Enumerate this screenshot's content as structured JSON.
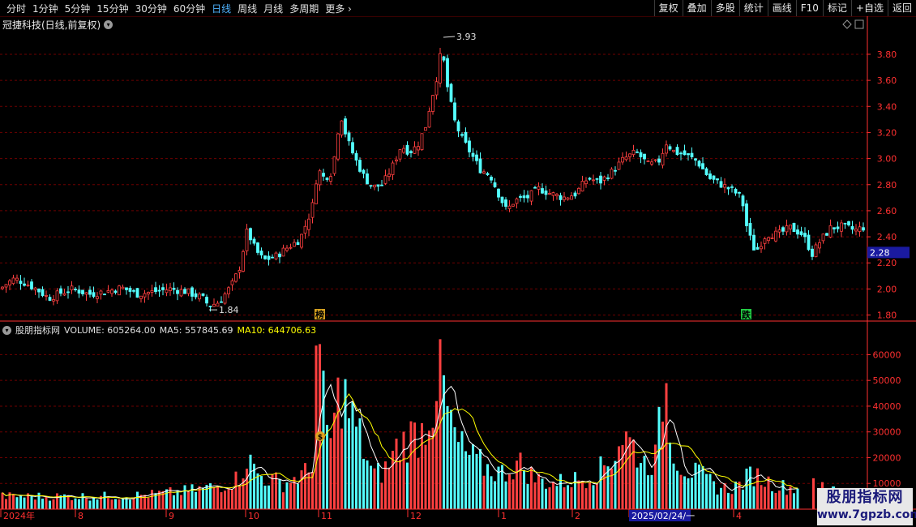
{
  "toolbar": {
    "periods": [
      "分时",
      "1分钟",
      "5分钟",
      "15分钟",
      "30分钟",
      "60分钟",
      "日线",
      "周线",
      "月线",
      "多周期",
      "更多"
    ],
    "active_period": "日线",
    "right_buttons": [
      "复权",
      "叠加",
      "多股",
      "统计",
      "画线",
      "F10",
      "标记",
      "+自选",
      "返回"
    ]
  },
  "price_panel": {
    "title": "冠捷科技(日线,前复权)",
    "current_price_tag": "2.28",
    "high_label": "3.93",
    "low_label": "1.84",
    "signal_up": "榜",
    "signal_down": "跌"
  },
  "volume_panel": {
    "indicator_name": "股朋指标网",
    "volume_text": "VOLUME: 605264.00",
    "ma5_text": "MA5: 557845.69",
    "ma10_text": "MA10: 644706.63",
    "coin_marker": "$"
  },
  "x_axis": {
    "labels": [
      "2024年",
      "8",
      "9",
      "10",
      "11",
      "12",
      "1",
      "2",
      "2025/02/24/一",
      "4"
    ]
  },
  "watermark": {
    "line1": "股朋指标网",
    "line2": "www.7gpzb.com"
  },
  "colors": {
    "up": "#ff4040",
    "down": "#54ffff",
    "ma5": "#ffffff",
    "ma10": "#ffff00",
    "grid": "#6e0000",
    "axis": "#ff3030"
  },
  "chart_data": [
    {
      "type": "candlestick",
      "title": "冠捷科技(日线,前复权)",
      "y_ticks": [
        3.8,
        3.6,
        3.4,
        3.2,
        3.0,
        2.8,
        2.6,
        2.4,
        2.2,
        2.0,
        1.8
      ],
      "ylim": [
        1.76,
        3.98
      ],
      "marked_high": 3.93,
      "marked_low": 1.84,
      "last_price": 2.28,
      "close_path": [
        [
          0,
          2.0
        ],
        [
          10,
          2.05
        ],
        [
          18,
          2.08
        ],
        [
          30,
          2.05
        ],
        [
          45,
          2.0
        ],
        [
          60,
          1.93
        ],
        [
          75,
          1.97
        ],
        [
          90,
          2.0
        ],
        [
          110,
          1.96
        ],
        [
          130,
          1.98
        ],
        [
          150,
          2.01
        ],
        [
          170,
          1.96
        ],
        [
          190,
          1.98
        ],
        [
          210,
          2.0
        ],
        [
          230,
          1.98
        ],
        [
          250,
          1.93
        ],
        [
          258,
          1.87
        ],
        [
          270,
          1.9
        ],
        [
          285,
          2.02
        ],
        [
          295,
          2.15
        ],
        [
          305,
          2.45
        ],
        [
          315,
          2.3
        ],
        [
          325,
          2.22
        ],
        [
          340,
          2.25
        ],
        [
          355,
          2.32
        ],
        [
          370,
          2.38
        ],
        [
          385,
          2.62
        ],
        [
          392,
          2.92
        ],
        [
          400,
          2.85
        ],
        [
          410,
          2.9
        ],
        [
          420,
          3.35
        ],
        [
          428,
          3.15
        ],
        [
          438,
          3.0
        ],
        [
          450,
          2.85
        ],
        [
          460,
          2.78
        ],
        [
          472,
          2.8
        ],
        [
          485,
          2.95
        ],
        [
          495,
          3.1
        ],
        [
          505,
          3.05
        ],
        [
          515,
          3.1
        ],
        [
          525,
          3.25
        ],
        [
          532,
          3.45
        ],
        [
          538,
          3.6
        ],
        [
          545,
          3.85
        ],
        [
          552,
          3.55
        ],
        [
          560,
          3.3
        ],
        [
          570,
          3.15
        ],
        [
          580,
          3.05
        ],
        [
          592,
          2.92
        ],
        [
          605,
          2.87
        ],
        [
          615,
          2.73
        ],
        [
          625,
          2.6
        ],
        [
          635,
          2.68
        ],
        [
          650,
          2.7
        ],
        [
          665,
          2.77
        ],
        [
          680,
          2.73
        ],
        [
          695,
          2.7
        ],
        [
          710,
          2.73
        ],
        [
          725,
          2.85
        ],
        [
          740,
          2.82
        ],
        [
          755,
          2.9
        ],
        [
          770,
          3.0
        ],
        [
          785,
          3.05
        ],
        [
          800,
          2.95
        ],
        [
          812,
          2.97
        ],
        [
          822,
          3.12
        ],
        [
          832,
          3.05
        ],
        [
          845,
          3.03
        ],
        [
          860,
          2.98
        ],
        [
          875,
          2.85
        ],
        [
          890,
          2.8
        ],
        [
          905,
          2.75
        ],
        [
          915,
          2.7
        ],
        [
          922,
          2.45
        ],
        [
          932,
          2.28
        ],
        [
          945,
          2.42
        ],
        [
          960,
          2.42
        ],
        [
          975,
          2.47
        ],
        [
          990,
          2.42
        ],
        [
          1002,
          2.27
        ],
        [
          1012,
          2.37
        ],
        [
          1025,
          2.47
        ],
        [
          1040,
          2.48
        ],
        [
          1055,
          2.45
        ],
        [
          1068,
          2.48
        ]
      ]
    },
    {
      "type": "bar",
      "title": "VOLUME",
      "y_ticks": [
        60000,
        50000,
        40000,
        30000,
        20000,
        10000
      ],
      "ylim": [
        0,
        68000
      ],
      "last_volume": 605264.0,
      "ma5": 557845.69,
      "ma10": 644706.63,
      "x_labels": [
        "2024年",
        "8",
        "9",
        "10",
        "11",
        "12",
        "1",
        "2",
        "2025/02/24/一",
        "4"
      ],
      "volume_path": [
        [
          0,
          5000
        ],
        [
          60,
          5000
        ],
        [
          120,
          5000
        ],
        [
          180,
          5500
        ],
        [
          230,
          7000
        ],
        [
          270,
          9000
        ],
        [
          295,
          12000
        ],
        [
          304,
          20000
        ],
        [
          320,
          13000
        ],
        [
          350,
          10000
        ],
        [
          385,
          15000
        ],
        [
          390,
          65000
        ],
        [
          396,
          50000
        ],
        [
          402,
          31000
        ],
        [
          410,
          27000
        ],
        [
          420,
          49000
        ],
        [
          430,
          38000
        ],
        [
          445,
          27000
        ],
        [
          460,
          13000
        ],
        [
          475,
          15000
        ],
        [
          490,
          24000
        ],
        [
          505,
          28000
        ],
        [
          520,
          30000
        ],
        [
          532,
          40000
        ],
        [
          543,
          57000
        ],
        [
          552,
          37000
        ],
        [
          565,
          25000
        ],
        [
          580,
          20000
        ],
        [
          600,
          16000
        ],
        [
          620,
          14000
        ],
        [
          640,
          18000
        ],
        [
          660,
          12000
        ],
        [
          680,
          10000
        ],
        [
          700,
          11000
        ],
        [
          720,
          12000
        ],
        [
          740,
          15000
        ],
        [
          755,
          20000
        ],
        [
          768,
          29000
        ],
        [
          780,
          25000
        ],
        [
          795,
          18000
        ],
        [
          810,
          20000
        ],
        [
          820,
          53000
        ],
        [
          826,
          34000
        ],
        [
          835,
          19000
        ],
        [
          850,
          15000
        ],
        [
          870,
          12000
        ],
        [
          885,
          8500
        ],
        [
          900,
          8000
        ],
        [
          915,
          10000
        ],
        [
          928,
          14000
        ],
        [
          945,
          11000
        ],
        [
          960,
          9000
        ],
        [
          985,
          8000
        ]
      ]
    }
  ]
}
